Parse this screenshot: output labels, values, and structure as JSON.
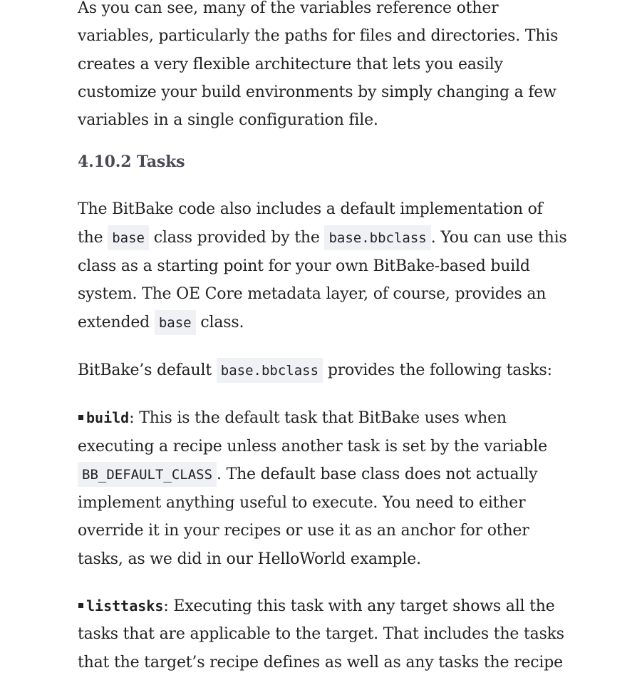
{
  "intro_paragraph": "As you can see, many of the variables reference other variables, particularly the paths for files and directories. This creates a very flexible architecture that lets you easily customize your build environments by simply changing a few variables in a single configuration file.",
  "section_heading": "4.10.2 Tasks",
  "para_bitbake_code": {
    "t1": "The BitBake code also includes a default implementation of the ",
    "c1": "base",
    "t2": " class provided by the ",
    "c2": "base.bbclass",
    "t3": ". You can use this class as a starting point for your own BitBake-based build system. The OE Core metadata layer, of course, provides an extended ",
    "c3": "base",
    "t4": " class."
  },
  "para_default": {
    "t1": "BitBake’s default ",
    "c1": "base.bbclass",
    "t2": " provides the following tasks:"
  },
  "tasks": [
    {
      "name": "build",
      "t1": ": This is the default task that BitBake uses when executing a recipe unless another task is set by the variable ",
      "code": "BB_DEFAULT_CLASS",
      "t2": ". The default base class does not actually implement anything useful to execute. You need to either override it in your recipes or use it as an anchor for other tasks, as we did in our HelloWorld example."
    },
    {
      "name": "listtasks",
      "t1": ": Executing this task with any target shows all the tasks that are applicable to the target. That includes the tasks that the target’s recipe defines as well as any tasks the recipe"
    }
  ]
}
